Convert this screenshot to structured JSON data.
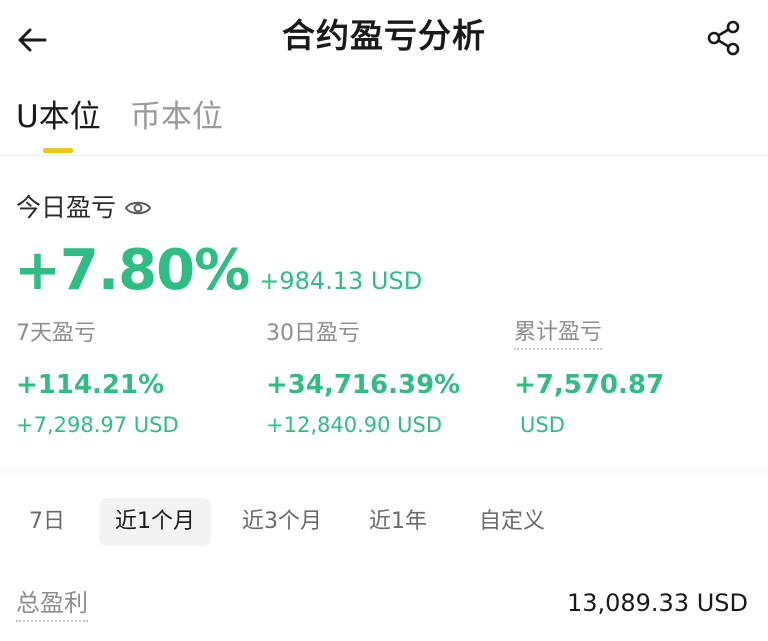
{
  "header": {
    "title": "合约盈亏分析",
    "back_icon": "arrow-left-icon",
    "share_icon": "share-icon"
  },
  "tabs": [
    {
      "label": "U本位",
      "active": true
    },
    {
      "label": "币本位",
      "active": false
    }
  ],
  "today": {
    "label": "今日盈亏",
    "percent": "+7.80%",
    "usd": "+984.13 USD"
  },
  "stats": [
    {
      "label": "7天盈亏",
      "percent": "+114.21%",
      "usd": "+7,298.97 USD"
    },
    {
      "label": "30日盈亏",
      "percent": "+34,716.39%",
      "usd": "+12,840.90 USD"
    },
    {
      "label": "累计盈亏",
      "percent": "+7,570.87",
      "usd": "USD"
    }
  ],
  "ranges": [
    {
      "label": "7日",
      "active": false
    },
    {
      "label": "近1个月",
      "active": true
    },
    {
      "label": "近3个月",
      "active": false
    },
    {
      "label": "近1年",
      "active": false
    },
    {
      "label": "自定义",
      "active": false
    }
  ],
  "total": {
    "label": "总盈利",
    "value": "13,089.33 USD"
  },
  "colors": {
    "profit_green": "#2ebd85",
    "accent_yellow": "#f0c419"
  }
}
